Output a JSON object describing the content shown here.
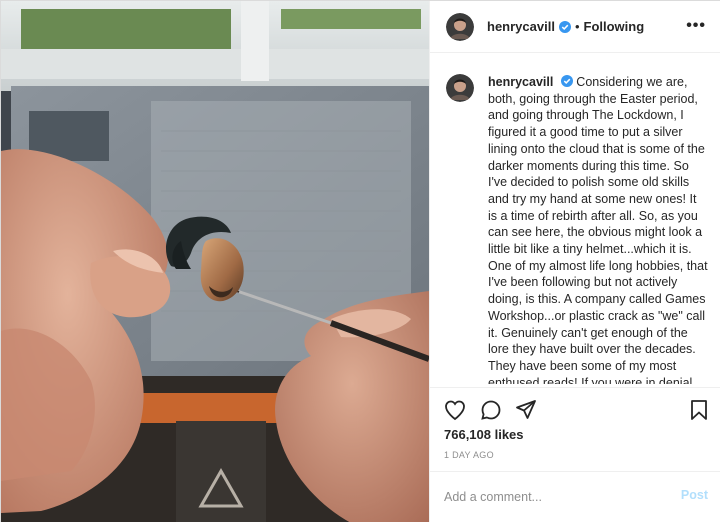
{
  "header": {
    "username": "henrycavill",
    "separator": "•",
    "follow_status": "Following",
    "more_label": "•••"
  },
  "caption": {
    "username": "henrycavill",
    "text": "Considering we are, both, going through the Easter period, and going through The Lockdown, I figured it a good time to put a silver lining onto the cloud that is some of the darker moments during this time. So I've decided to polish some old skills and try my hand at some new ones! It is a time of rebirth after all. So, as you can see here, the obvious might look a little bit like a tiny helmet...which it is. One of my almost life long hobbies, that I've been following but not actively doing, is this. A company called Games Workshop...or plastic crack as \"we\" call it. Genuinely can't get enough of the lore they have built over the decades. They have been some of my most enthused reads! If you were in denial about me being a geek before, you can't hide from it now. Also, in the"
  },
  "actions": {
    "icons": [
      "heart-icon",
      "comment-icon",
      "share-icon",
      "bookmark-icon"
    ]
  },
  "stats": {
    "likes": "766,108 likes",
    "timestamp": "1 DAY AGO"
  },
  "comment": {
    "placeholder": "Add a comment...",
    "post_label": "Post"
  },
  "colors": {
    "verified": "#3897f0",
    "post_disabled": "#b2dffc",
    "muted": "#8e8e8e"
  }
}
